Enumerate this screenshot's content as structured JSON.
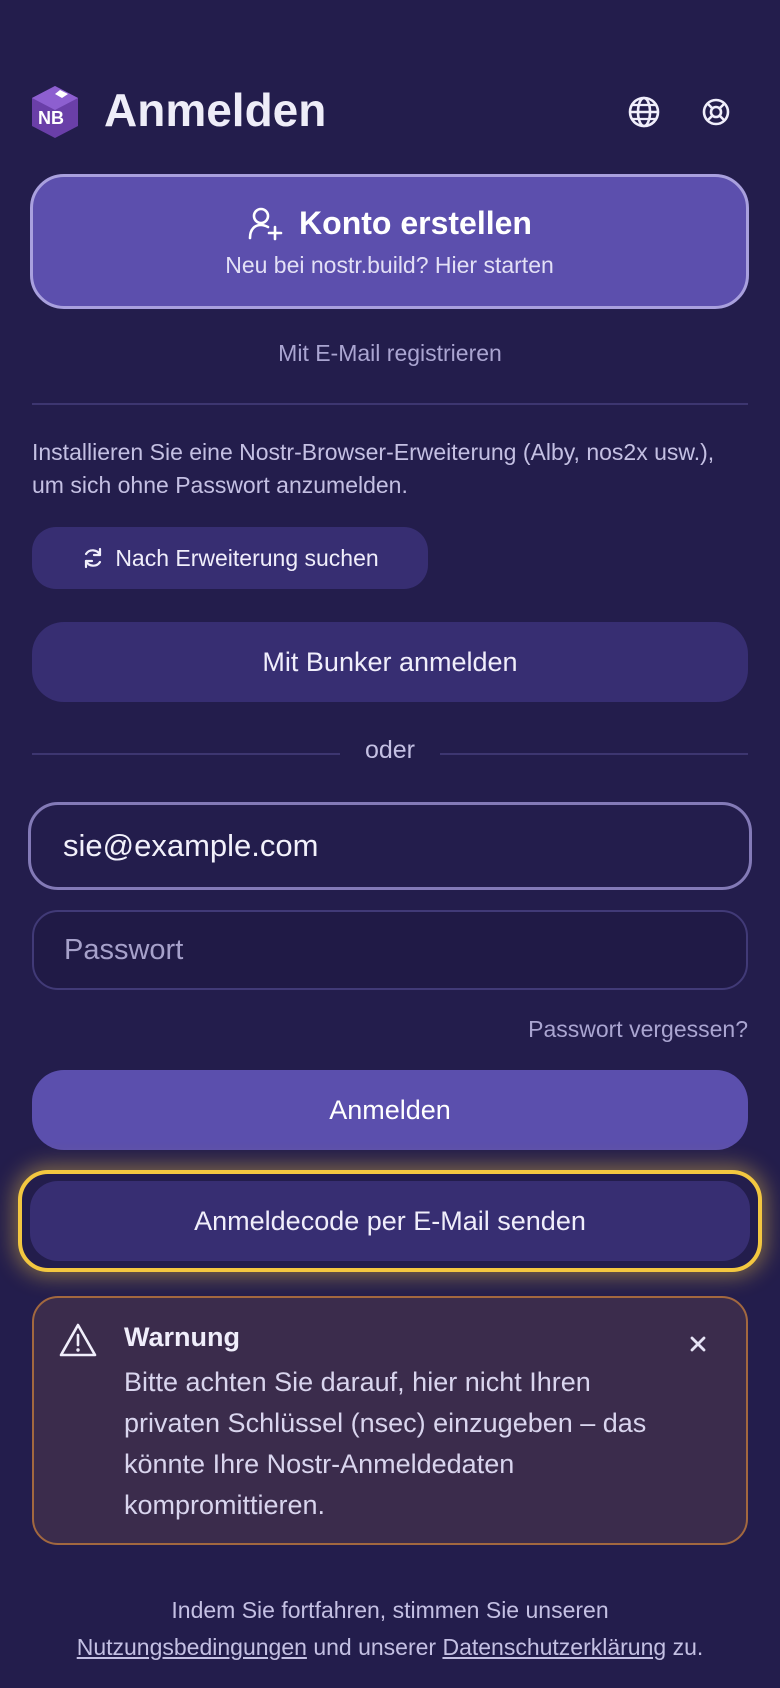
{
  "header": {
    "logo_text": "NB",
    "title": "Anmelden",
    "language_icon": "globe-icon",
    "help_icon": "lifebuoy-icon"
  },
  "create_account": {
    "icon": "user-plus-icon",
    "label": "Konto erstellen",
    "subtitle": "Neu bei nostr.build? Hier starten"
  },
  "register_email_link": "Mit E-Mail registrieren",
  "extension_info": "Installieren Sie eine Nostr-Browser-Erweiterung (Alby, nos2x usw.), um sich ohne Passwort anzumelden.",
  "extension_button": {
    "icon": "refresh-icon",
    "label": "Nach Erweiterung suchen"
  },
  "bunker_button": "Mit Bunker anmelden",
  "or_divider": "oder",
  "email_field": {
    "value": "sie@example.com"
  },
  "password_field": {
    "placeholder": "Passwort"
  },
  "forgot_password": "Passwort vergessen?",
  "login_button": "Anmelden",
  "email_code_button": "Anmeldecode per E-Mail senden",
  "warning": {
    "icon": "warning-triangle-icon",
    "title": "Warnung",
    "body": "Bitte achten Sie darauf, hier nicht Ihren privaten Schlüssel (nsec) einzugeben – das könnte Ihre Nostr-Anmeldedaten kompromittieren.",
    "close_icon": "close-icon"
  },
  "footer": {
    "prefix": "Indem Sie fortfahren, stimmen Sie unseren",
    "terms": "Nutzungsbedingungen",
    "middle": "und unserer",
    "privacy": "Datenschutzerklärung",
    "suffix": "zu."
  },
  "colors": {
    "background": "#231d4c",
    "primary": "#5b4fad",
    "secondary": "#372e72",
    "focus_highlight": "#f3c740",
    "warning_border": "#a2683f"
  }
}
